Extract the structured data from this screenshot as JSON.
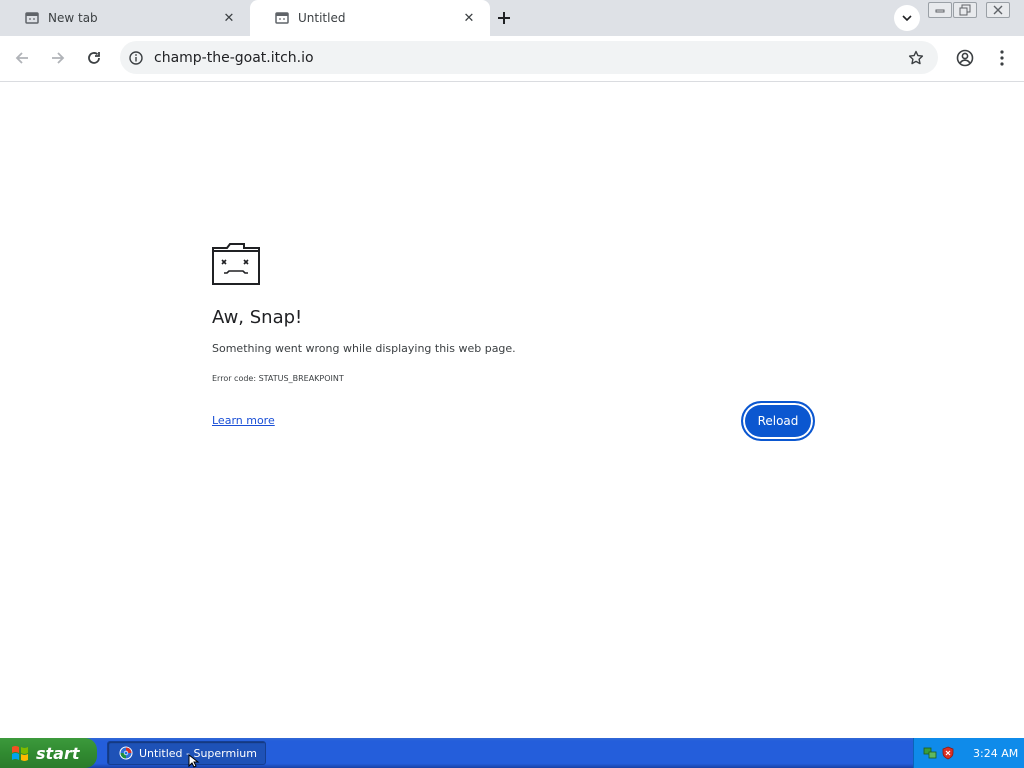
{
  "browser": {
    "tabs": [
      {
        "title": "New tab",
        "active": false
      },
      {
        "title": "Untitled",
        "active": true
      }
    ],
    "url": "champ-the-goat.itch.io"
  },
  "error_page": {
    "title": "Aw, Snap!",
    "message": "Something went wrong while displaying this web page.",
    "error_code": "Error code: STATUS_BREAKPOINT",
    "learn_more": "Learn more",
    "reload": "Reload"
  },
  "taskbar": {
    "start_label": "start",
    "task_item": "Untitled - Supermium",
    "clock": "3:24 AM"
  },
  "colors": {
    "accent": "#0b57d0",
    "link": "#1a4fd6",
    "tab_strip": "#dee1e6",
    "taskbar": "#245edb",
    "start_button": "#318b31",
    "tray": "#0f8bea"
  }
}
